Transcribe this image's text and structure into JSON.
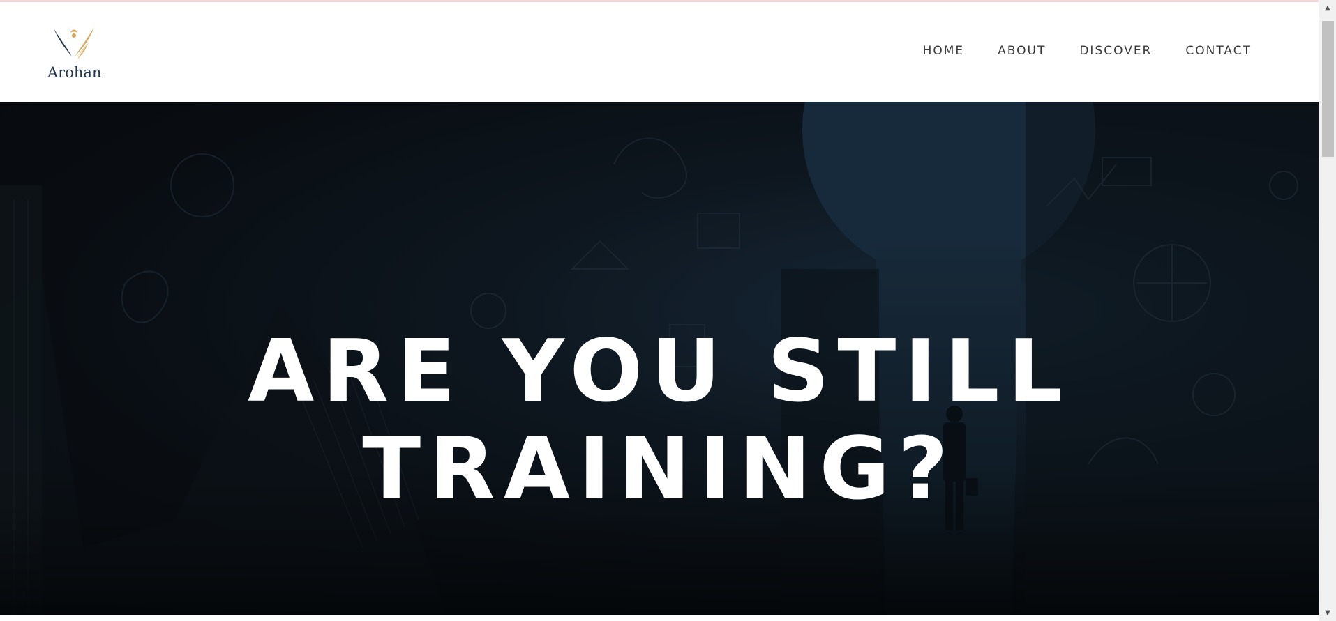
{
  "brand": {
    "name": "Arohan",
    "logo_icon": "phoenix-wings-logo",
    "colors": {
      "navy": "#1f3550",
      "gold": "#d4a657"
    }
  },
  "nav": {
    "items": [
      {
        "label": "HOME"
      },
      {
        "label": "ABOUT"
      },
      {
        "label": "DISCOVER"
      },
      {
        "label": "CONTACT"
      }
    ]
  },
  "hero": {
    "title_line1": "ARE YOU STILL",
    "title_line2": "TRAINING?",
    "background_icon": "keyhole-doorway-doodles-image"
  },
  "scrollbar": {
    "up_icon": "scroll-up-arrow-icon",
    "down_icon": "scroll-down-arrow-icon"
  }
}
